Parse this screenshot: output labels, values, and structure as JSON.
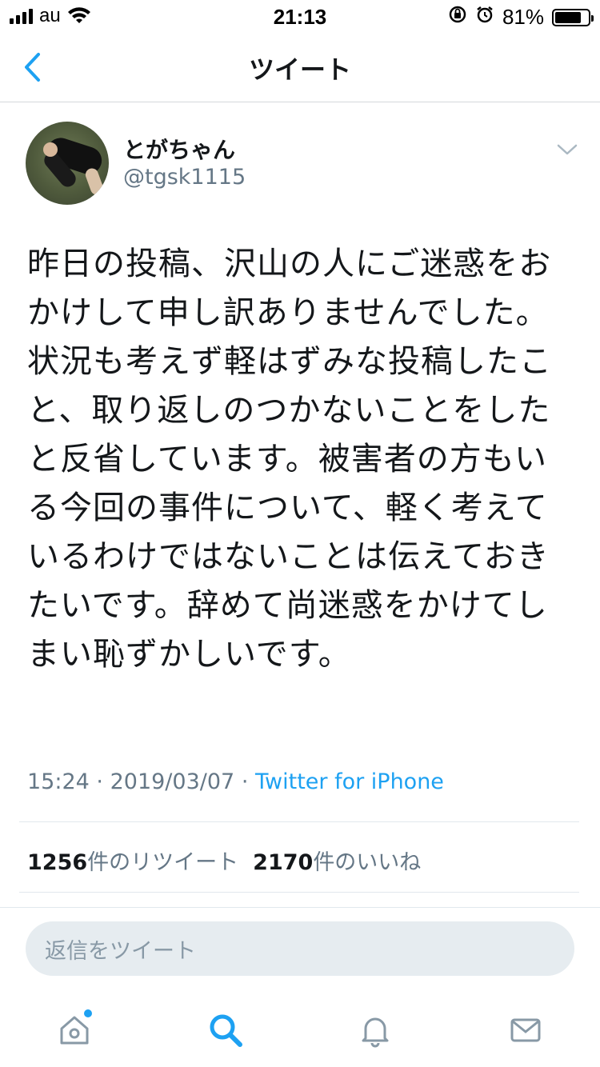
{
  "status_bar": {
    "carrier": "au",
    "time": "21:13",
    "battery_percent": "81%",
    "battery_level": 0.81,
    "icons": [
      "signal-icon",
      "wifi-icon",
      "rotation-lock-icon",
      "alarm-icon",
      "battery-icon"
    ]
  },
  "nav": {
    "title": "ツイート",
    "back_icon": "chevron-left-icon"
  },
  "tweet": {
    "display_name": "とがちゃん",
    "handle": "@tgsk1115",
    "text": "昨日の投稿、沢山の人にご迷惑をおかけして申し訳ありませんでした。状況も考えず軽はずみな投稿したこと、取り返しのつかないことをしたと反省しています。被害者の方もいる今回の事件について、軽く考えているわけではないことは伝えておきたいです。辞めて尚迷惑をかけてしまい恥ずかしいです。",
    "time": "15:24",
    "separator": "·",
    "date": "2019/03/07",
    "source": "Twitter for iPhone"
  },
  "stats": {
    "retweets_count": "1256",
    "retweets_label": "件のリツイート",
    "likes_count": "2170",
    "likes_label": "件のいいね"
  },
  "reply": {
    "placeholder": "返信をツイート"
  },
  "tab_bar": {
    "tabs": [
      "home-icon",
      "search-icon",
      "notifications-icon",
      "messages-icon"
    ]
  },
  "colors": {
    "accent": "#1da1f2",
    "muted": "#657786",
    "text": "#14171a",
    "reply_bg": "#e6ecf0"
  }
}
